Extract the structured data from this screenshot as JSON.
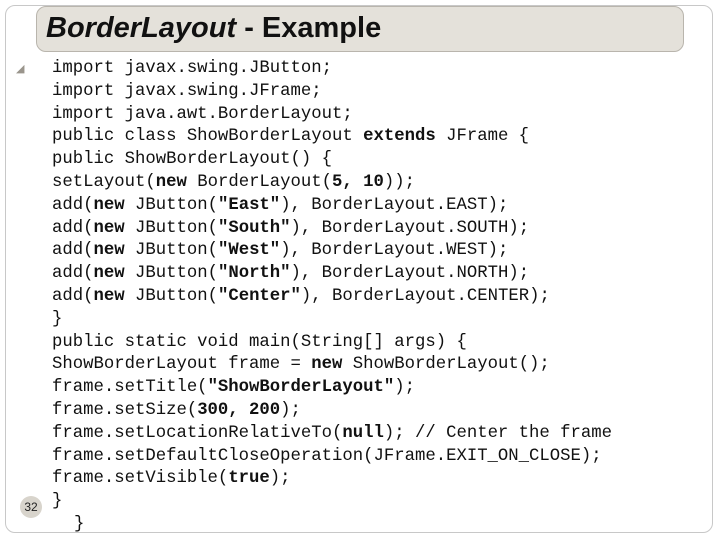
{
  "slide": {
    "title_italic": "BorderLayout",
    "title_rest": " - Example",
    "slide_number": "32"
  },
  "code_lines": [
    [
      {
        "t": "import javax.swing.JButton;"
      }
    ],
    [
      {
        "t": "import javax.swing.JFrame;"
      }
    ],
    [
      {
        "t": "import java.awt.BorderLayout;"
      }
    ],
    [
      {
        "t": "public class ShowBorderLayout "
      },
      {
        "t": "extends",
        "b": true
      },
      {
        "t": " JFrame {"
      }
    ],
    [
      {
        "t": "public ShowBorderLayout() {"
      }
    ],
    [
      {
        "t": "setLayout("
      },
      {
        "t": "new",
        "b": true
      },
      {
        "t": " BorderLayout("
      },
      {
        "t": "5, 10",
        "b": true
      },
      {
        "t": "));"
      }
    ],
    [
      {
        "t": "add("
      },
      {
        "t": "new",
        "b": true
      },
      {
        "t": " JButton("
      },
      {
        "t": "\"East\"",
        "b": true
      },
      {
        "t": "), BorderLayout.EAST);"
      }
    ],
    [
      {
        "t": "add("
      },
      {
        "t": "new",
        "b": true
      },
      {
        "t": " JButton("
      },
      {
        "t": "\"South\"",
        "b": true
      },
      {
        "t": "), BorderLayout.SOUTH);"
      }
    ],
    [
      {
        "t": "add("
      },
      {
        "t": "new",
        "b": true
      },
      {
        "t": " JButton("
      },
      {
        "t": "\"West\"",
        "b": true
      },
      {
        "t": "), BorderLayout.WEST);"
      }
    ],
    [
      {
        "t": "add("
      },
      {
        "t": "new",
        "b": true
      },
      {
        "t": " JButton("
      },
      {
        "t": "\"North\"",
        "b": true
      },
      {
        "t": "), BorderLayout.NORTH);"
      }
    ],
    [
      {
        "t": "add("
      },
      {
        "t": "new",
        "b": true
      },
      {
        "t": " JButton("
      },
      {
        "t": "\"Center\"",
        "b": true
      },
      {
        "t": "), BorderLayout.CENTER);"
      }
    ],
    [
      {
        "t": "}"
      }
    ],
    [
      {
        "t": "public static void main(String[] args) {"
      }
    ],
    [
      {
        "t": "ShowBorderLayout frame = "
      },
      {
        "t": "new",
        "b": true
      },
      {
        "t": " ShowBorderLayout();"
      }
    ],
    [
      {
        "t": "frame.setTitle("
      },
      {
        "t": "\"ShowBorderLayout\"",
        "b": true
      },
      {
        "t": ");"
      }
    ],
    [
      {
        "t": "frame.setSize("
      },
      {
        "t": "300, 200",
        "b": true
      },
      {
        "t": ");"
      }
    ],
    [
      {
        "t": "frame.setLocationRelativeTo("
      },
      {
        "t": "null",
        "b": true
      },
      {
        "t": "); // Center the frame"
      }
    ],
    [
      {
        "t": "frame.setDefaultCloseOperation(JFrame.EXIT_ON_CLOSE);"
      }
    ],
    [
      {
        "t": "frame.setVisible("
      },
      {
        "t": "true",
        "b": true
      },
      {
        "t": ");"
      }
    ],
    [
      {
        "t": "}"
      }
    ],
    [
      {
        "t": "}"
      }
    ]
  ]
}
